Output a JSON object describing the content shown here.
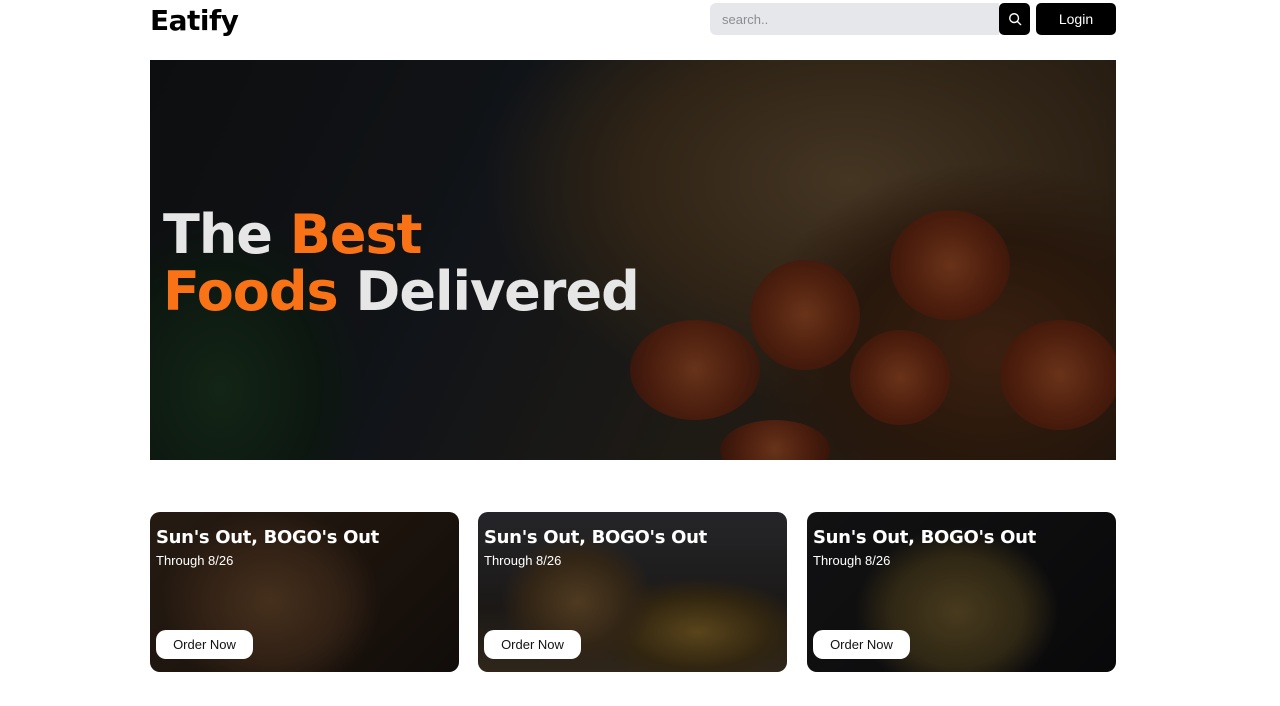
{
  "brand": {
    "logo": "Eatify"
  },
  "search": {
    "placeholder": "search..",
    "icon": "search-icon"
  },
  "auth": {
    "login_label": "Login"
  },
  "hero": {
    "title_word1": "The",
    "title_word2": "Best",
    "title_word3": "Foods",
    "title_word4": "Delivered",
    "accent_color": "#f97316"
  },
  "promos": [
    {
      "title": "Sun's Out, BOGO's Out",
      "subtitle": "Through 8/26",
      "button": "Order Now"
    },
    {
      "title": "Sun's Out, BOGO's Out",
      "subtitle": "Through 8/26",
      "button": "Order Now"
    },
    {
      "title": "Sun's Out, BOGO's Out",
      "subtitle": "Through 8/26",
      "button": "Order Now"
    }
  ]
}
